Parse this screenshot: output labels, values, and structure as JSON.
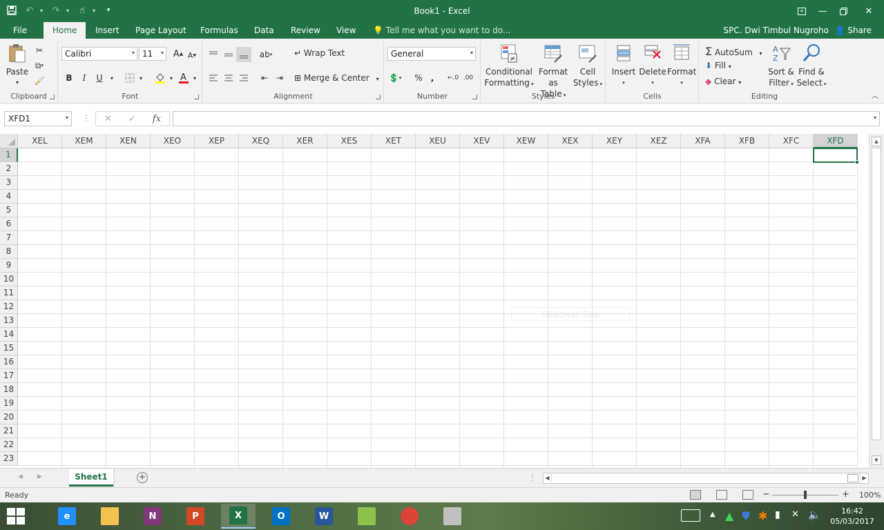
{
  "window": {
    "title": "Book1 - Excel"
  },
  "quick_access": {
    "save_icon": "save-icon",
    "undo_icon": "undo-icon",
    "redo_icon": "redo-icon",
    "touch_icon": "touch-mode-icon",
    "customize_icon": "customize-icon"
  },
  "tabs": [
    {
      "label": "File",
      "active": false
    },
    {
      "label": "Home",
      "active": true
    },
    {
      "label": "Insert",
      "active": false
    },
    {
      "label": "Page Layout",
      "active": false
    },
    {
      "label": "Formulas",
      "active": false
    },
    {
      "label": "Data",
      "active": false
    },
    {
      "label": "Review",
      "active": false
    },
    {
      "label": "View",
      "active": false
    }
  ],
  "tell_me": "Tell me what you want to do...",
  "user_name": "SPC. Dwi Timbul Nugroho",
  "share_label": "Share",
  "ribbon": {
    "clipboard": {
      "label": "Clipboard",
      "paste": "Paste"
    },
    "font": {
      "label": "Font",
      "name": "Calibri",
      "size": "11",
      "bold": "B",
      "italic": "I",
      "underline": "U",
      "grow": "A",
      "shrink": "A"
    },
    "alignment": {
      "label": "Alignment",
      "wrap_text": "Wrap Text",
      "merge_center": "Merge & Center"
    },
    "number": {
      "label": "Number",
      "format": "General",
      "percent": "%",
      "comma": ","
    },
    "styles": {
      "label": "Styles",
      "conditional_1": "Conditional",
      "conditional_2": "Formatting",
      "format_table_1": "Format as",
      "format_table_2": "Table",
      "cell_styles_1": "Cell",
      "cell_styles_2": "Styles"
    },
    "cells": {
      "label": "Cells",
      "insert": "Insert",
      "delete": "Delete",
      "format": "Format"
    },
    "editing": {
      "label": "Editing",
      "autosum": "AutoSum",
      "fill": "Fill",
      "clear": "Clear",
      "sort_1": "Sort &",
      "sort_2": "Filter",
      "find_1": "Find &",
      "find_2": "Select"
    }
  },
  "formula_bar": {
    "name_box": "XFD1",
    "fx": "fx",
    "value": ""
  },
  "grid": {
    "columns": [
      "XEL",
      "XEM",
      "XEN",
      "XEO",
      "XEP",
      "XEQ",
      "XER",
      "XES",
      "XET",
      "XEU",
      "XEV",
      "XEW",
      "XEX",
      "XEY",
      "XEZ",
      "XFA",
      "XFB",
      "XFC",
      "XFD"
    ],
    "rows": [
      "1",
      "2",
      "3",
      "4",
      "5",
      "6",
      "7",
      "8",
      "9",
      "10",
      "11",
      "12",
      "13",
      "14",
      "15",
      "16",
      "17",
      "18",
      "19",
      "20",
      "21",
      "22",
      "23"
    ],
    "selected_column": "XFD",
    "selected_row": "1",
    "ghost_text": "Fullscreen Snip"
  },
  "sheets": [
    {
      "label": "Sheet1",
      "active": true
    }
  ],
  "status": {
    "ready": "Ready",
    "zoom": "100%"
  },
  "taskbar": {
    "apps": [
      {
        "name": "internet-explorer",
        "letter": "e",
        "color": "#1e90ff"
      },
      {
        "name": "file-explorer",
        "letter": "",
        "color": "#f2c14e"
      },
      {
        "name": "onenote",
        "letter": "N",
        "color": "#80397b"
      },
      {
        "name": "powerpoint",
        "letter": "P",
        "color": "#d24726"
      },
      {
        "name": "excel",
        "letter": "X",
        "color": "#217346"
      },
      {
        "name": "outlook",
        "letter": "O",
        "color": "#0072c6"
      },
      {
        "name": "word",
        "letter": "W",
        "color": "#2b579a"
      },
      {
        "name": "notepad-chart",
        "letter": "",
        "color": "#8bc34a"
      },
      {
        "name": "chrome",
        "letter": "",
        "color": "#db4437"
      },
      {
        "name": "snipping-tool",
        "letter": "",
        "color": "#c0c0c0"
      }
    ],
    "time": "16:42",
    "date": "05/03/2017"
  }
}
